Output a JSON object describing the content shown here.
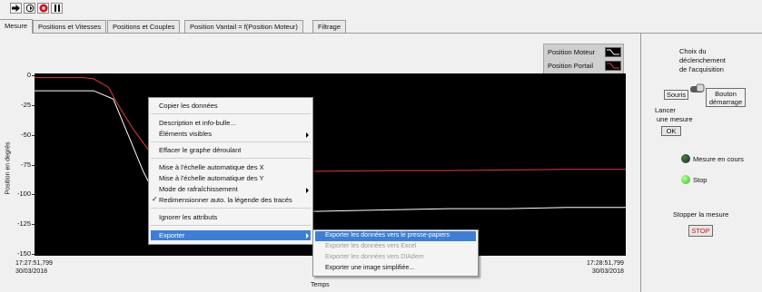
{
  "tabs": [
    {
      "label": "Mesure"
    },
    {
      "label": "Positions et Vitesses"
    },
    {
      "label": "Positions et Couples"
    },
    {
      "label": "Position Vantail = f(Position Moteur)"
    },
    {
      "label": "Filtrage"
    }
  ],
  "toolbar": {
    "icons": [
      "run-arrow-icon",
      "run-continuous-icon",
      "abort-stop-icon",
      "pause-icon"
    ]
  },
  "legend": {
    "items": [
      {
        "label": "Position Moteur",
        "color": "#ffffff"
      },
      {
        "label": "Position Portail",
        "color": "#e03a3a"
      }
    ]
  },
  "chart_data": {
    "type": "line",
    "ylabel": "Position en degrés",
    "xlabel": "Temps",
    "ylim": [
      -150,
      0
    ],
    "y_ticks": [
      "0",
      "-25",
      "-50",
      "-75",
      "-100",
      "-125",
      "-150"
    ],
    "x_start": {
      "time": "17:27:51,799",
      "date": "30/03/2018"
    },
    "x_end": {
      "time": "17:28:51,799",
      "date": "30/03/2018"
    },
    "xlim": [
      0,
      60
    ],
    "background": "#000000",
    "series": [
      {
        "name": "Position Moteur",
        "color": "#ffffff",
        "points": [
          [
            0,
            -13
          ],
          [
            4,
            -13
          ],
          [
            6,
            -13
          ],
          [
            8,
            -20
          ],
          [
            9.5,
            -50
          ],
          [
            11,
            -80
          ],
          [
            12.5,
            -105
          ],
          [
            13.5,
            -115
          ],
          [
            15,
            -116
          ],
          [
            17,
            -116
          ],
          [
            19,
            -115.5
          ],
          [
            24,
            -115
          ],
          [
            30,
            -114
          ],
          [
            36,
            -113
          ],
          [
            42,
            -112
          ],
          [
            48,
            -112
          ],
          [
            54,
            -111
          ],
          [
            60,
            -111
          ]
        ]
      },
      {
        "name": "Position Portail",
        "color": "#e03a3a",
        "points": [
          [
            0,
            -2
          ],
          [
            5,
            -2
          ],
          [
            6,
            -3
          ],
          [
            7.5,
            -10
          ],
          [
            8.5,
            -25
          ],
          [
            10,
            -45
          ],
          [
            11.5,
            -62
          ],
          [
            12.5,
            -75
          ],
          [
            13.5,
            -81
          ],
          [
            15,
            -81.5
          ],
          [
            17,
            -80.5
          ],
          [
            19,
            -81
          ],
          [
            24,
            -81
          ],
          [
            30,
            -80.5
          ],
          [
            36,
            -80
          ],
          [
            42,
            -80
          ],
          [
            48,
            -79.5
          ],
          [
            54,
            -79
          ],
          [
            60,
            -79
          ]
        ]
      }
    ]
  },
  "context_menu": {
    "items": [
      {
        "label": "Copier les données"
      },
      {
        "label": "Description et info-bulle..."
      },
      {
        "label": "Éléments visibles"
      },
      {
        "label": "Effacer le graphe déroulant"
      },
      {
        "label": "Mise à l'échelle automatique des X"
      },
      {
        "label": "Mise à l'échelle automatique des Y"
      },
      {
        "label": "Mode de rafraîchissement"
      },
      {
        "label": "Redimensionner auto. la légende des tracés"
      },
      {
        "label": "Ignorer les attributs"
      },
      {
        "label": "Exporter"
      }
    ],
    "submenu": [
      {
        "label": "Exporter les données vers le presse-papiers"
      },
      {
        "label": "Exporter les données vers Excel"
      },
      {
        "label": "Exporter les données vers DIAdem"
      },
      {
        "label": "Exporter une image simplifiée..."
      }
    ]
  },
  "right_panel": {
    "trigger_title_1": "Choix du",
    "trigger_title_2": "déclenchement",
    "trigger_title_3": "de l'acquisition",
    "switch_left": "Souris",
    "switch_right_1": "Bouton",
    "switch_right_2": "démarrage",
    "launch_1": "Lancer",
    "launch_2": "une mesure",
    "ok_label": "OK",
    "status_running": "Mesure en cours",
    "status_stop": "Stop",
    "stop_title": "Stopper la mesure",
    "stop_button": "STOP"
  }
}
